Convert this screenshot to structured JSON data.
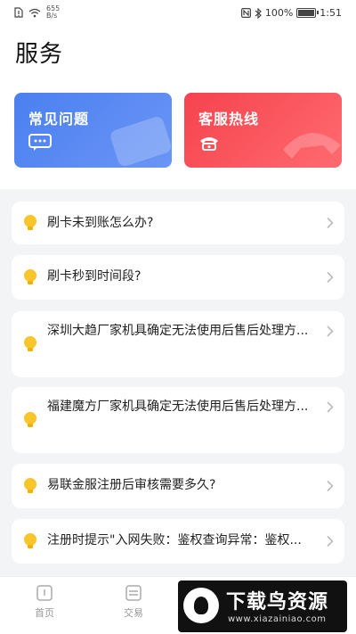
{
  "status_bar": {
    "network_speed": "655\nB/s",
    "battery": "100%",
    "time": "1:51",
    "battery_level": 1.0
  },
  "page": {
    "title": "服务"
  },
  "cards": [
    {
      "label": "常见问题",
      "icon": "chat-bubble-icon",
      "color": "#4a80f0"
    },
    {
      "label": "客服热线",
      "icon": "phone-icon",
      "color": "#f5434e"
    }
  ],
  "faq_items": [
    {
      "text": "刷卡未到账怎么办?"
    },
    {
      "text": "刷卡秒到时间段?"
    },
    {
      "text": "深圳大趋厂家机具确定无法使用后售后处理方..."
    },
    {
      "text": "福建魔方厂家机具确定无法使用后售后处理方..."
    },
    {
      "text": "易联金服注册后审核需要多久?"
    },
    {
      "text": "注册时提示\"入网失败：鉴权查询异常：鉴权..."
    }
  ],
  "tab_bar": {
    "tabs": [
      {
        "label": "首页",
        "icon": "home-icon"
      },
      {
        "label": "交易",
        "icon": "transaction-icon"
      }
    ]
  },
  "watermark": {
    "title": "下载鸟资源",
    "url": "www.xiazainiao.com"
  }
}
